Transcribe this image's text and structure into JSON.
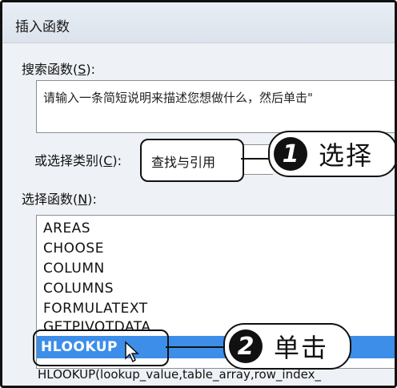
{
  "dialog": {
    "title": "插入函数"
  },
  "search": {
    "label_prefix": "搜索函数(",
    "label_key": "S",
    "label_suffix": "):",
    "text": "请输入一条简短说明来描述您想做什么，然后单击\""
  },
  "category": {
    "label_prefix": "或选择类别(",
    "label_key": "C",
    "label_suffix": "):",
    "value": "查找与引用"
  },
  "functions": {
    "label_prefix": "选择函数(",
    "label_key": "N",
    "label_suffix": "):",
    "items": [
      "AREAS",
      "CHOOSE",
      "COLUMN",
      "COLUMNS",
      "FORMULATEXT",
      "GETPIVOTDATA"
    ],
    "selected": "HLOOKUP",
    "signature": "HLOOKUP(lookup_value,table_array,row_index_"
  },
  "callouts": [
    {
      "number": "1",
      "text": "选择"
    },
    {
      "number": "2",
      "text": "单击"
    }
  ],
  "colors": {
    "selection": "#3c8ee8",
    "dialog_bg": "#eef1f5"
  }
}
